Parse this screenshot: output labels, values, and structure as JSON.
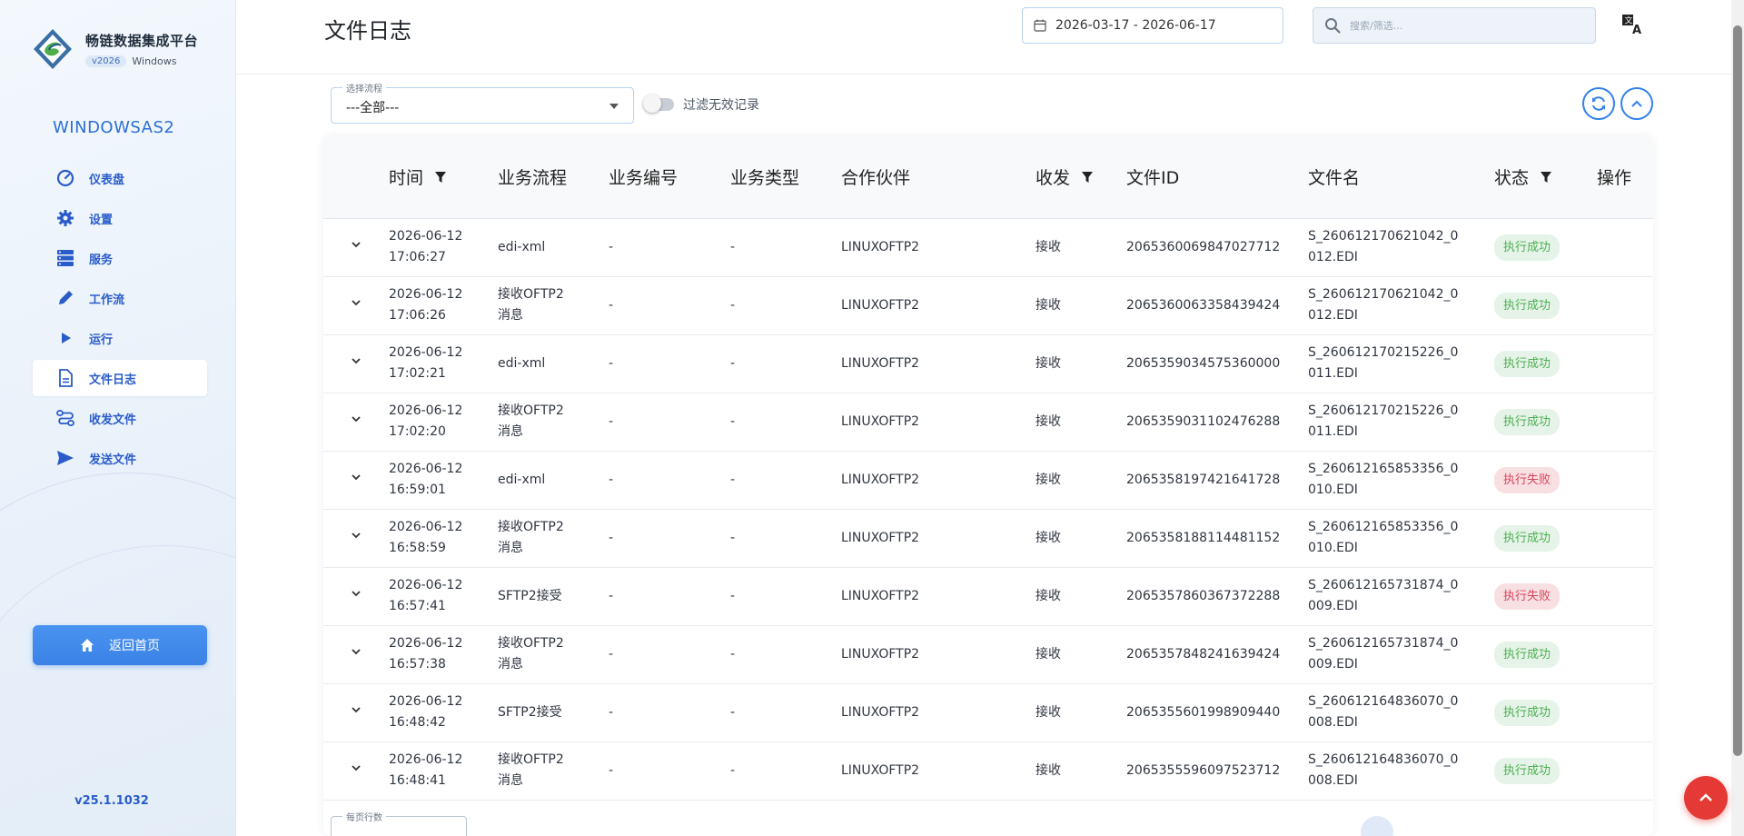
{
  "app": {
    "title": "畅链数据集成平台",
    "version_badge": "v2026",
    "platform": "Windows",
    "host": "WINDOWSAS2",
    "home_button": "返回首页",
    "build_version": "v25.1.1032"
  },
  "sidebar": {
    "items": [
      {
        "label": "仪表盘",
        "icon": "gauge-icon"
      },
      {
        "label": "设置",
        "icon": "gear-icon"
      },
      {
        "label": "服务",
        "icon": "server-icon"
      },
      {
        "label": "工作流",
        "icon": "pencil-icon"
      },
      {
        "label": "运行",
        "icon": "play-icon"
      },
      {
        "label": "文件日志",
        "icon": "document-icon",
        "active": true
      },
      {
        "label": "收发文件",
        "icon": "transfer-icon"
      },
      {
        "label": "发送文件",
        "icon": "send-icon"
      }
    ]
  },
  "header": {
    "title": "文件日志",
    "date_range": "2026-03-17 - 2026-06-17",
    "search_placeholder": "搜索/筛选..."
  },
  "filters": {
    "flow_select_label": "选择流程",
    "flow_select_value": "---全部---",
    "toggle_label": "过滤无效记录",
    "toggle_on": false
  },
  "table": {
    "columns": {
      "time": "时间",
      "flow": "业务流程",
      "biz_no": "业务编号",
      "biz_type": "业务类型",
      "partner": "合作伙伴",
      "direction": "收发",
      "file_id": "文件ID",
      "file_name": "文件名",
      "status": "状态",
      "action": "操作"
    },
    "rows": [
      {
        "date": "2026-06-12",
        "time": "17:06:27",
        "flow1": "edi-xml",
        "flow2": "",
        "biz_no": "-",
        "biz_type": "-",
        "partner": "LINUXOFTP2",
        "direction": "接收",
        "file_id": "2065360069847027712",
        "name1": "S_260612170621042_0",
        "name2": "012.EDI",
        "status": "执行成功",
        "status_kind": "ok"
      },
      {
        "date": "2026-06-12",
        "time": "17:06:26",
        "flow1": "接收OFTP2",
        "flow2": "消息",
        "biz_no": "-",
        "biz_type": "-",
        "partner": "LINUXOFTP2",
        "direction": "接收",
        "file_id": "2065360063358439424",
        "name1": "S_260612170621042_0",
        "name2": "012.EDI",
        "status": "执行成功",
        "status_kind": "ok"
      },
      {
        "date": "2026-06-12",
        "time": "17:02:21",
        "flow1": "edi-xml",
        "flow2": "",
        "biz_no": "-",
        "biz_type": "-",
        "partner": "LINUXOFTP2",
        "direction": "接收",
        "file_id": "2065359034575360000",
        "name1": "S_260612170215226_0",
        "name2": "011.EDI",
        "status": "执行成功",
        "status_kind": "ok"
      },
      {
        "date": "2026-06-12",
        "time": "17:02:20",
        "flow1": "接收OFTP2",
        "flow2": "消息",
        "biz_no": "-",
        "biz_type": "-",
        "partner": "LINUXOFTP2",
        "direction": "接收",
        "file_id": "2065359031102476288",
        "name1": "S_260612170215226_0",
        "name2": "011.EDI",
        "status": "执行成功",
        "status_kind": "ok"
      },
      {
        "date": "2026-06-12",
        "time": "16:59:01",
        "flow1": "edi-xml",
        "flow2": "",
        "biz_no": "-",
        "biz_type": "-",
        "partner": "LINUXOFTP2",
        "direction": "接收",
        "file_id": "2065358197421641728",
        "name1": "S_260612165853356_0",
        "name2": "010.EDI",
        "status": "执行失败",
        "status_kind": "fail"
      },
      {
        "date": "2026-06-12",
        "time": "16:58:59",
        "flow1": "接收OFTP2",
        "flow2": "消息",
        "biz_no": "-",
        "biz_type": "-",
        "partner": "LINUXOFTP2",
        "direction": "接收",
        "file_id": "2065358188114481152",
        "name1": "S_260612165853356_0",
        "name2": "010.EDI",
        "status": "执行成功",
        "status_kind": "ok"
      },
      {
        "date": "2026-06-12",
        "time": "16:57:41",
        "flow1": "SFTP2接受",
        "flow2": "",
        "biz_no": "-",
        "biz_type": "-",
        "partner": "LINUXOFTP2",
        "direction": "接收",
        "file_id": "2065357860367372288",
        "name1": "S_260612165731874_0",
        "name2": "009.EDI",
        "status": "执行失败",
        "status_kind": "fail"
      },
      {
        "date": "2026-06-12",
        "time": "16:57:38",
        "flow1": "接收OFTP2",
        "flow2": "消息",
        "biz_no": "-",
        "biz_type": "-",
        "partner": "LINUXOFTP2",
        "direction": "接收",
        "file_id": "2065357848241639424",
        "name1": "S_260612165731874_0",
        "name2": "009.EDI",
        "status": "执行成功",
        "status_kind": "ok"
      },
      {
        "date": "2026-06-12",
        "time": "16:48:42",
        "flow1": "SFTP2接受",
        "flow2": "",
        "biz_no": "-",
        "biz_type": "-",
        "partner": "LINUXOFTP2",
        "direction": "接收",
        "file_id": "2065355601998909440",
        "name1": "S_260612164836070_0",
        "name2": "008.EDI",
        "status": "执行成功",
        "status_kind": "ok"
      },
      {
        "date": "2026-06-12",
        "time": "16:48:41",
        "flow1": "接收OFTP2",
        "flow2": "消息",
        "biz_no": "-",
        "biz_type": "-",
        "partner": "LINUXOFTP2",
        "direction": "接收",
        "file_id": "2065355596097523712",
        "name1": "S_260612164836070_0",
        "name2": "008.EDI",
        "status": "执行成功",
        "status_kind": "ok"
      }
    ]
  },
  "pagination": {
    "rows_per_page_label": "每页行数"
  },
  "colors": {
    "accent": "#2f80ed",
    "success_bg": "#e5f3e8",
    "success_fg": "#4caf50",
    "fail_bg": "#f8dfe2",
    "fail_fg": "#d8455a",
    "fab": "#e53935"
  }
}
